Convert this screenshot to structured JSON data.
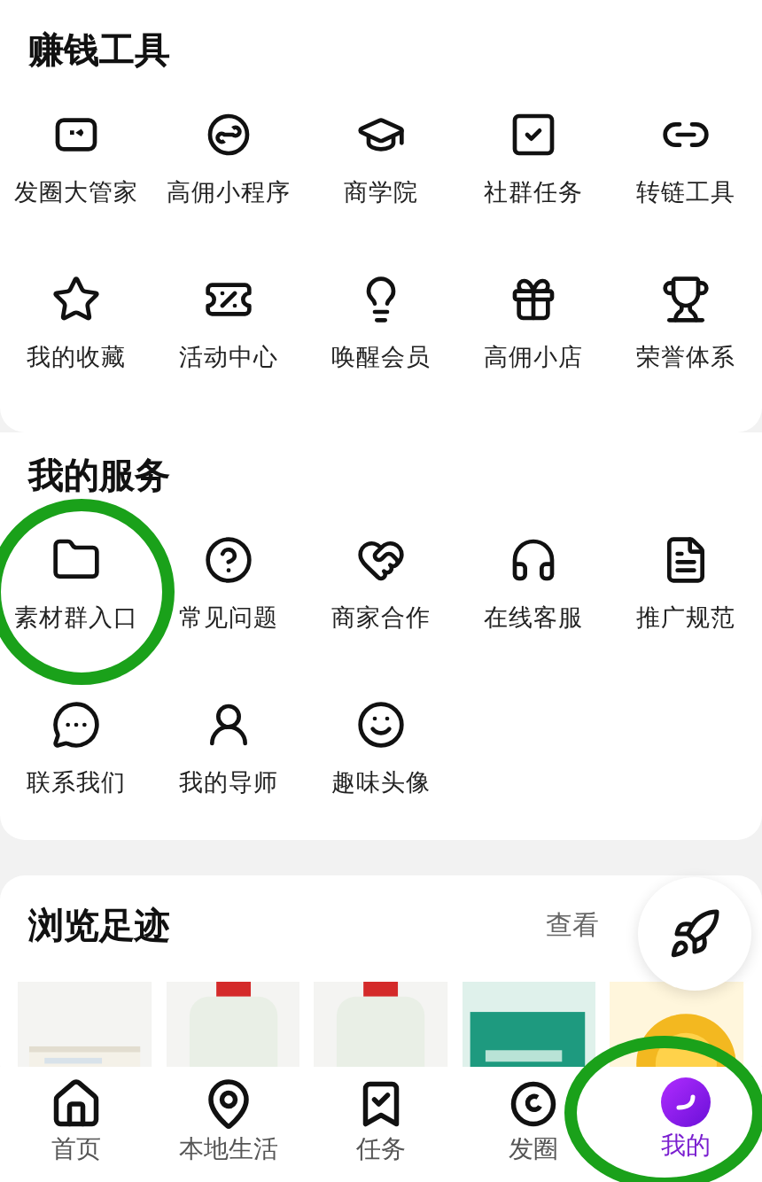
{
  "sections": [
    {
      "title": "赚钱工具",
      "items": [
        {
          "label": "发圈大管家"
        },
        {
          "label": "高佣小程序"
        },
        {
          "label": "商学院"
        },
        {
          "label": "社群任务"
        },
        {
          "label": "转链工具"
        },
        {
          "label": "我的收藏"
        },
        {
          "label": "活动中心"
        },
        {
          "label": "唤醒会员"
        },
        {
          "label": "高佣小店"
        },
        {
          "label": "荣誉体系"
        }
      ]
    },
    {
      "title": "我的服务",
      "items": [
        {
          "label": "素材群入口"
        },
        {
          "label": "常见问题"
        },
        {
          "label": "商家合作"
        },
        {
          "label": "在线客服"
        },
        {
          "label": "推广规范"
        },
        {
          "label": "联系我们"
        },
        {
          "label": "我的导师"
        },
        {
          "label": "趣味头像"
        }
      ]
    }
  ],
  "history": {
    "title": "浏览足迹",
    "more": "查看"
  },
  "tab_bar": [
    {
      "label": "首页",
      "selected": false
    },
    {
      "label": "本地生活",
      "selected": false
    },
    {
      "label": "任务",
      "selected": false
    },
    {
      "label": "发圈",
      "selected": false
    },
    {
      "label": "我的",
      "selected": true
    }
  ]
}
